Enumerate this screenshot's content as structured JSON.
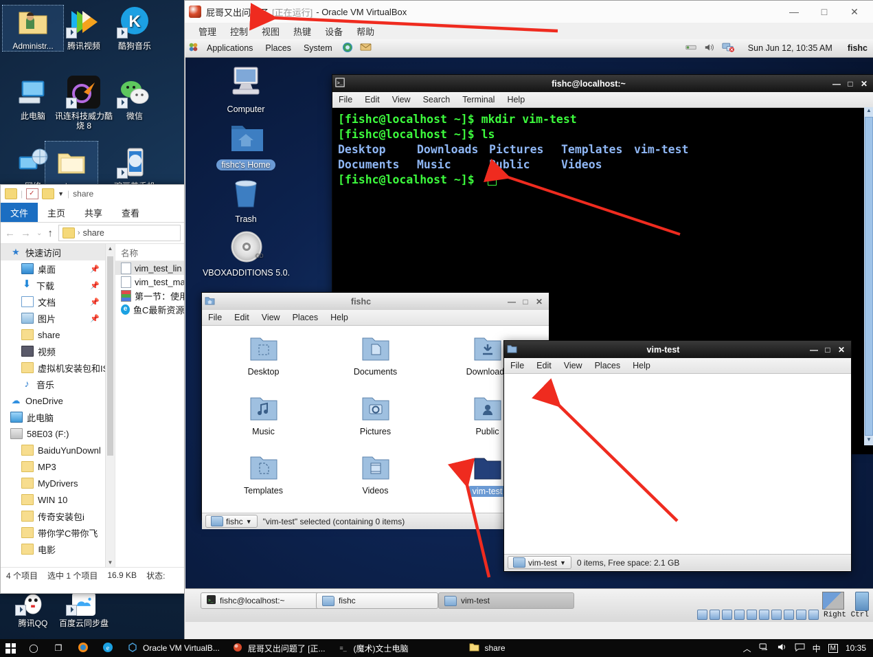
{
  "windows_desktop": {
    "icons": [
      {
        "label": "Administr...",
        "icon": "user-folder-icon",
        "selected": true
      },
      {
        "label": "腾讯视频",
        "icon": "tencent-video-icon",
        "shortcut": true
      },
      {
        "label": "酷狗音乐",
        "icon": "kugou-music-icon",
        "shortcut": true
      },
      {
        "label": "此电脑",
        "icon": "this-pc-icon"
      },
      {
        "label": "讯连科技威力酷烧 8",
        "icon": "cyberlink-power2go-icon",
        "shortcut": true
      },
      {
        "label": "微信",
        "icon": "wechat-icon",
        "shortcut": true
      },
      {
        "label": "网络",
        "icon": "network-icon"
      },
      {
        "label": "share",
        "icon": "folder-icon",
        "dotted": true
      },
      {
        "label": "豌豆荚手机",
        "icon": "phone-icon",
        "shortcut": true
      },
      {
        "label": "腾讯QQ",
        "icon": "qq-icon",
        "shortcut": true
      },
      {
        "label": "百度云同步盘",
        "icon": "baidu-cloud-icon",
        "shortcut": true
      }
    ]
  },
  "explorer": {
    "title": "share",
    "quick_access_icons": [
      "folder-icon",
      "properties-icon",
      "new-folder-icon",
      "dropdown-icon"
    ],
    "ribbon_tabs": [
      {
        "label": "文件",
        "active": true
      },
      {
        "label": "主页",
        "active": false
      },
      {
        "label": "共享",
        "active": false
      },
      {
        "label": "查看",
        "active": false
      }
    ],
    "address": {
      "crumb_root": "folder-icon",
      "crumb": "share",
      "sep": "›"
    },
    "nav_buttons": {
      "back": "←",
      "forward": "→",
      "recent": "⌄",
      "up": "↑"
    },
    "tree": [
      {
        "label": "快速访问",
        "icon": "star-icon",
        "indent": 0,
        "highlight": true,
        "pin": false
      },
      {
        "label": "桌面",
        "icon": "desktop-icon",
        "indent": 1,
        "pin": true
      },
      {
        "label": "下载",
        "icon": "download-icon",
        "indent": 1,
        "pin": true
      },
      {
        "label": "文档",
        "icon": "documents-icon",
        "indent": 1,
        "pin": true
      },
      {
        "label": "图片",
        "icon": "pictures-icon",
        "indent": 1,
        "pin": true
      },
      {
        "label": "share",
        "icon": "folder-icon",
        "indent": 1,
        "pin": false
      },
      {
        "label": "视频",
        "icon": "videos-icon",
        "indent": 1,
        "pin": false
      },
      {
        "label": "虚拟机安装包和IS",
        "icon": "folder-icon",
        "indent": 1,
        "pin": false
      },
      {
        "label": "音乐",
        "icon": "music-icon",
        "indent": 1,
        "pin": false
      },
      {
        "label": "OneDrive",
        "icon": "onedrive-icon",
        "indent": 0,
        "pin": false
      },
      {
        "label": "此电脑",
        "icon": "this-pc-icon",
        "indent": 0,
        "pin": false
      },
      {
        "label": "58E03 (F:)",
        "icon": "drive-icon",
        "indent": 0,
        "pin": false
      },
      {
        "label": "BaiduYunDownl",
        "icon": "folder-icon",
        "indent": 1,
        "pin": false
      },
      {
        "label": "MP3",
        "icon": "folder-icon",
        "indent": 1,
        "pin": false
      },
      {
        "label": "MyDrivers",
        "icon": "folder-icon",
        "indent": 1,
        "pin": false
      },
      {
        "label": "WIN 10",
        "icon": "folder-icon",
        "indent": 1,
        "pin": false
      },
      {
        "label": "传奇安装包i",
        "icon": "folder-icon",
        "indent": 1,
        "pin": false
      },
      {
        "label": "带你学C带你飞",
        "icon": "folder-icon",
        "indent": 1,
        "pin": false
      },
      {
        "label": "电影",
        "icon": "folder-icon",
        "indent": 1,
        "pin": false
      }
    ],
    "list_header": "名称",
    "files": [
      {
        "name": "vim_test_lin",
        "icon": "text-file-icon",
        "selected": true
      },
      {
        "name": "vim_test_ma",
        "icon": "text-file-icon",
        "selected": false
      },
      {
        "name": "第一节：使用",
        "icon": "book-icon",
        "selected": false
      },
      {
        "name": "鱼C最新资源",
        "icon": "ie-shortcut-icon",
        "selected": false
      }
    ],
    "status": {
      "count": "4 个项目",
      "selection": "选中 1 个项目",
      "size": "16.9 KB",
      "state": "状态:"
    }
  },
  "virtualbox": {
    "title_app": "屁哥又出问题了",
    "title_state": "[正在运行]",
    "title_suffix": "- Oracle VM VirtualBox",
    "menu": [
      "管理",
      "控制",
      "视图",
      "热键",
      "设备",
      "帮助"
    ],
    "window_buttons": {
      "minimize": "—",
      "maximize": "□",
      "close": "✕"
    }
  },
  "gnome": {
    "top_panel": {
      "menus": [
        "Applications",
        "Places",
        "System"
      ],
      "launchers": [
        "firefox-icon",
        "evolution-icon"
      ],
      "tray": [
        "printer-icon",
        "volume-icon",
        "network-disconnected-icon"
      ],
      "clock": "Sun Jun 12, 10:35 AM",
      "user": "fishc"
    },
    "desktop_icons": [
      {
        "label": "Computer",
        "icon": "computer-icon",
        "selected": false
      },
      {
        "label": "fishc's Home",
        "icon": "home-folder-icon",
        "selected": true
      },
      {
        "label": "Trash",
        "icon": "trash-icon",
        "selected": false
      },
      {
        "label": "VBOXADDITIONS 5.0.",
        "icon": "cd-icon",
        "selected": false
      }
    ],
    "taskbar": [
      {
        "label": "fishc@localhost:~",
        "icon": "terminal-icon",
        "active": false
      },
      {
        "label": "fishc",
        "icon": "home-folder-icon",
        "active": false
      },
      {
        "label": "vim-test",
        "icon": "folder-icon",
        "active": true
      }
    ],
    "vm_status_icons": [
      "hdd-icon",
      "cd-icon",
      "network-icon",
      "usb-icon",
      "shared-folder-icon",
      "display-icon",
      "capture-icon",
      "vm-icon",
      "guest-additions-icon",
      "download-icon"
    ],
    "host_key": "Right Ctrl"
  },
  "terminal": {
    "title": "fishc@localhost:~",
    "menu": [
      "File",
      "Edit",
      "View",
      "Search",
      "Terminal",
      "Help"
    ],
    "window_buttons": {
      "minimize": "—",
      "maximize": "□",
      "close": "✕"
    },
    "lines": [
      {
        "prompt": "[fishc@localhost ~]$",
        "cmd": "mkdir vim-test"
      },
      {
        "prompt": "[fishc@localhost ~]$",
        "cmd": "ls"
      }
    ],
    "ls_row1": [
      "Desktop",
      "Downloads",
      "Pictures",
      "Templates",
      "vim-test"
    ],
    "ls_row2": [
      "Documents",
      "Music",
      "Public",
      "Videos"
    ],
    "last_prompt": "[fishc@localhost ~]$",
    "colors": {
      "prompt": "#3dfb3d",
      "dir": "#8fb7f5",
      "bg": "#000000"
    }
  },
  "fishc_window": {
    "title": "fishc",
    "menu": [
      "File",
      "Edit",
      "View",
      "Places",
      "Help"
    ],
    "window_buttons": {
      "minimize": "—",
      "maximize": "□",
      "close": "✕"
    },
    "items": [
      {
        "name": "Desktop",
        "icon": "desktop-folder-icon",
        "selected": false
      },
      {
        "name": "Documents",
        "icon": "documents-folder-icon",
        "selected": false
      },
      {
        "name": "Downloads",
        "icon": "downloads-folder-icon",
        "selected": false
      },
      {
        "name": "Music",
        "icon": "music-folder-icon",
        "selected": false
      },
      {
        "name": "Pictures",
        "icon": "pictures-folder-icon",
        "selected": false
      },
      {
        "name": "Public",
        "icon": "public-folder-icon",
        "selected": false
      },
      {
        "name": "Templates",
        "icon": "templates-folder-icon",
        "selected": false
      },
      {
        "name": "Videos",
        "icon": "videos-folder-icon",
        "selected": false
      },
      {
        "name": "vim-test",
        "icon": "folder-icon",
        "selected": true
      }
    ],
    "path_button": "fishc",
    "status": "\"vim-test\" selected (containing 0 items)"
  },
  "vimtest_window": {
    "title": "vim-test",
    "menu": [
      "File",
      "Edit",
      "View",
      "Places",
      "Help"
    ],
    "window_buttons": {
      "minimize": "—",
      "maximize": "□",
      "close": "✕"
    },
    "path_button": "vim-test",
    "status": "0 items, Free space: 2.1 GB"
  },
  "taskbar": {
    "start": "start-icon",
    "search": "search-circle-icon",
    "taskview": "task-view-icon",
    "items": [
      {
        "label": "",
        "icon": "firefox-icon"
      },
      {
        "label": "",
        "icon": "edge-icon"
      },
      {
        "label": "Oracle VM VirtualB...",
        "icon": "virtualbox-icon"
      },
      {
        "label": "屁哥又出问题了 [正...",
        "icon": "virtualbox-vm-icon"
      },
      {
        "label": "(魔术)文士电脑",
        "icon": "text-icon"
      },
      {
        "label": "share",
        "icon": "folder-icon"
      }
    ],
    "tray": {
      "chevron": "︿",
      "network": "network-icon",
      "volume": "volume-icon",
      "action": "action-center-icon",
      "ime": "中",
      "ime2": "M",
      "clock": "10:35"
    }
  },
  "annotations": {
    "arrows": [
      "arrow-to-vbox-title",
      "arrow-to-terminal-prompt",
      "arrow-to-vimtest-folder",
      "arrow-to-vimtest-window"
    ],
    "color": "#ef2b1f"
  }
}
